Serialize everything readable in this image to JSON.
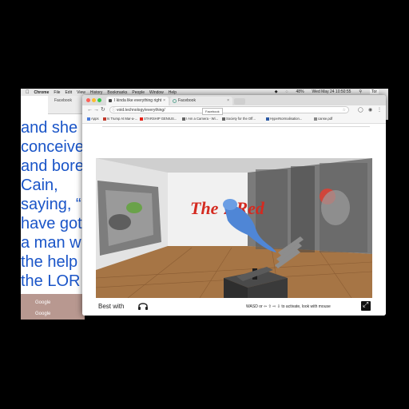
{
  "menubar": {
    "apple": "",
    "app": "Chrome",
    "items": [
      "File",
      "Edit",
      "View",
      "History",
      "Bookmarks",
      "People",
      "Window",
      "Help"
    ],
    "battery": "48%",
    "datetime": "Wed May 24 10:50:55",
    "user": "Tor"
  },
  "back_window": {
    "tab_label": "Facebook",
    "lines": [
      "and she",
      "conceive",
      "and bore",
      "Cain,",
      "saying, “",
      "have got",
      "a man w",
      "the help",
      "the LOR"
    ],
    "text_color": "#1a55c8",
    "dock_items": [
      "Google",
      "Google"
    ]
  },
  "chrome": {
    "tabs": [
      {
        "label": "I kinda like everything right"
      },
      {
        "label": "Facebook"
      }
    ],
    "tooltip": "Facebook",
    "url": "void.technology/everything/",
    "bookmarks": [
      {
        "label": "Apps",
        "icon": "apps-grid-icon",
        "color": "#4a7bd9"
      },
      {
        "label": "Is Trump At Mar-a-...",
        "icon": "page-icon",
        "color": "#c0392b"
      },
      {
        "label": "STARSHIP GENIUS...",
        "icon": "youtube-icon",
        "color": "#e62117"
      },
      {
        "label": "I Am a Camera - Wi...",
        "icon": "wikipedia-icon",
        "color": "#666666"
      },
      {
        "label": "Society for the Off...",
        "icon": "wikipedia-icon",
        "color": "#666666"
      },
      {
        "label": "HyperNormalisation...",
        "icon": "page-icon",
        "color": "#2d5aa5"
      },
      {
        "label": "canse.pdf",
        "icon": "file-icon",
        "color": "#888888"
      }
    ]
  },
  "page": {
    "scene_text": "The 7 Red",
    "best_with": "Best with",
    "hint": "WASD or ⇦ ⇧ ⇨ ⇩ to activate, look with mouse",
    "accent_red": "#d42a20",
    "figure_blue": "#4f86d6"
  }
}
